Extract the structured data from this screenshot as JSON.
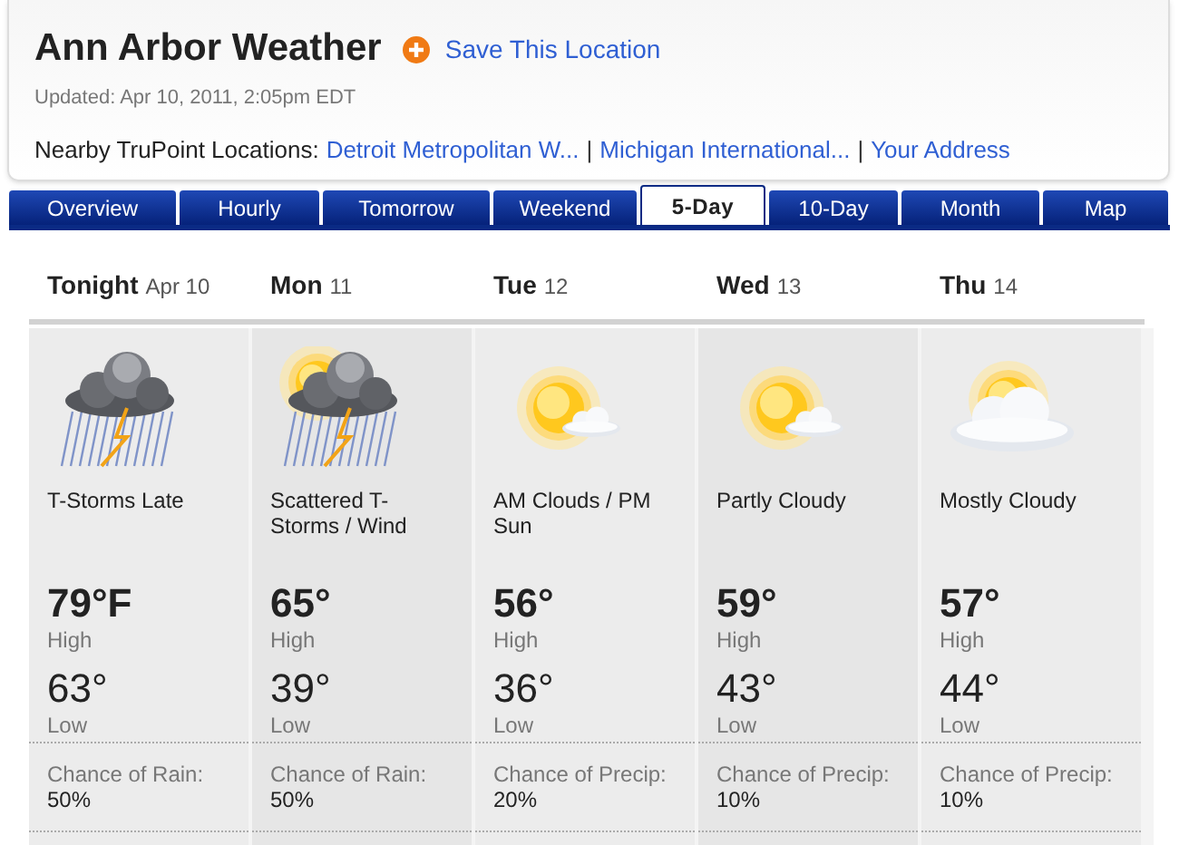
{
  "header": {
    "title": "Ann Arbor Weather",
    "save_link": "Save This Location",
    "updated": "Updated: Apr 10, 2011, 2:05pm EDT",
    "nearby_label": "Nearby TruPoint Locations:",
    "nearby_links": [
      "Detroit Metropolitan W...",
      "Michigan International...",
      "Your Address"
    ],
    "separator": "|"
  },
  "tabs": [
    {
      "label": "Overview",
      "selected": false
    },
    {
      "label": "Hourly",
      "selected": false
    },
    {
      "label": "Tomorrow",
      "selected": false
    },
    {
      "label": "Weekend",
      "selected": false
    },
    {
      "label": "5-Day",
      "selected": true
    },
    {
      "label": "10-Day",
      "selected": false
    },
    {
      "label": "Month",
      "selected": false
    },
    {
      "label": "Map",
      "selected": false
    }
  ],
  "days": [
    {
      "day": "Tonight",
      "date": "Apr 10",
      "kind": "storm",
      "condition": "T-Storms Late",
      "high": "79°F",
      "high_label": "High",
      "low": "63°",
      "low_label": "Low",
      "chance_label": "Chance of Rain:",
      "chance": "50%"
    },
    {
      "day": "Mon",
      "date": "11",
      "kind": "sun-storm",
      "condition": "Scattered T-Storms / Wind",
      "high": "65°",
      "high_label": "High",
      "low": "39°",
      "low_label": "Low",
      "chance_label": "Chance of Rain:",
      "chance": "50%"
    },
    {
      "day": "Tue",
      "date": "12",
      "kind": "partly-sunny",
      "condition": "AM Clouds / PM Sun",
      "high": "56°",
      "high_label": "High",
      "low": "36°",
      "low_label": "Low",
      "chance_label": "Chance of Precip:",
      "chance": "20%"
    },
    {
      "day": "Wed",
      "date": "13",
      "kind": "partly-sunny",
      "condition": "Partly Cloudy",
      "high": "59°",
      "high_label": "High",
      "low": "43°",
      "low_label": "Low",
      "chance_label": "Chance of Precip:",
      "chance": "10%"
    },
    {
      "day": "Thu",
      "date": "14",
      "kind": "mostly-cloudy",
      "condition": "Mostly Cloudy",
      "high": "57°",
      "high_label": "High",
      "low": "44°",
      "low_label": "Low",
      "chance_label": "Chance of Precip:",
      "chance": "10%"
    }
  ]
}
